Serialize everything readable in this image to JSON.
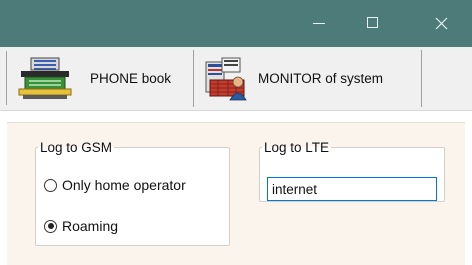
{
  "window": {
    "controls": {
      "minimize_icon": "minimize-icon",
      "maximize_icon": "maximize-icon",
      "close_icon": "close-icon"
    }
  },
  "toolbar": {
    "phone_book_label": "PHONE book",
    "monitor_label": "MONITOR of system"
  },
  "gsm": {
    "group_label": "Log to GSM",
    "options": [
      {
        "label": "Only home operator",
        "checked": false
      },
      {
        "label": "Roaming",
        "checked": true
      }
    ]
  },
  "lte": {
    "group_label": "Log to LTE",
    "value": "internet"
  },
  "colors": {
    "titlebar": "#4d7b7a",
    "toolbar": "#f0f0f0",
    "panel": "#faf4ec",
    "input_focus": "#0078d7"
  }
}
